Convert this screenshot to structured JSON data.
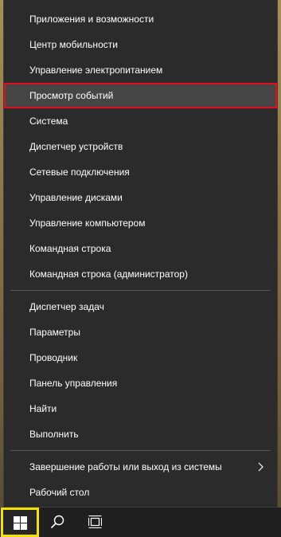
{
  "menu": {
    "group1": [
      {
        "label": "Приложения и возможности"
      },
      {
        "label": "Центр мобильности"
      },
      {
        "label": "Управление электропитанием"
      },
      {
        "label": "Просмотр событий",
        "selected": true
      },
      {
        "label": "Система"
      },
      {
        "label": "Диспетчер устройств"
      },
      {
        "label": "Сетевые подключения"
      },
      {
        "label": "Управление дисками"
      },
      {
        "label": "Управление компьютером"
      },
      {
        "label": "Командная строка"
      },
      {
        "label": "Командная строка (администратор)"
      }
    ],
    "group2": [
      {
        "label": "Диспетчер задач"
      },
      {
        "label": "Параметры"
      },
      {
        "label": "Проводник"
      },
      {
        "label": "Панель управления"
      },
      {
        "label": "Найти"
      },
      {
        "label": "Выполнить"
      }
    ],
    "group3": [
      {
        "label": "Завершение работы или выход из системы",
        "has_submenu": true,
        "submenu_icon": "chevron-right-icon"
      },
      {
        "label": "Рабочий стол"
      }
    ]
  },
  "taskbar": {
    "start_icon": "windows-logo-icon",
    "search_icon": "search-icon",
    "taskview_icon": "task-view-icon"
  },
  "colors": {
    "menu_background": "#2b2b2b",
    "menu_text": "#ffffff",
    "selected_background": "#454545",
    "selected_outline": "#e0101c",
    "start_highlight": "#f2e200",
    "taskbar_background": "#1f1f1f"
  }
}
